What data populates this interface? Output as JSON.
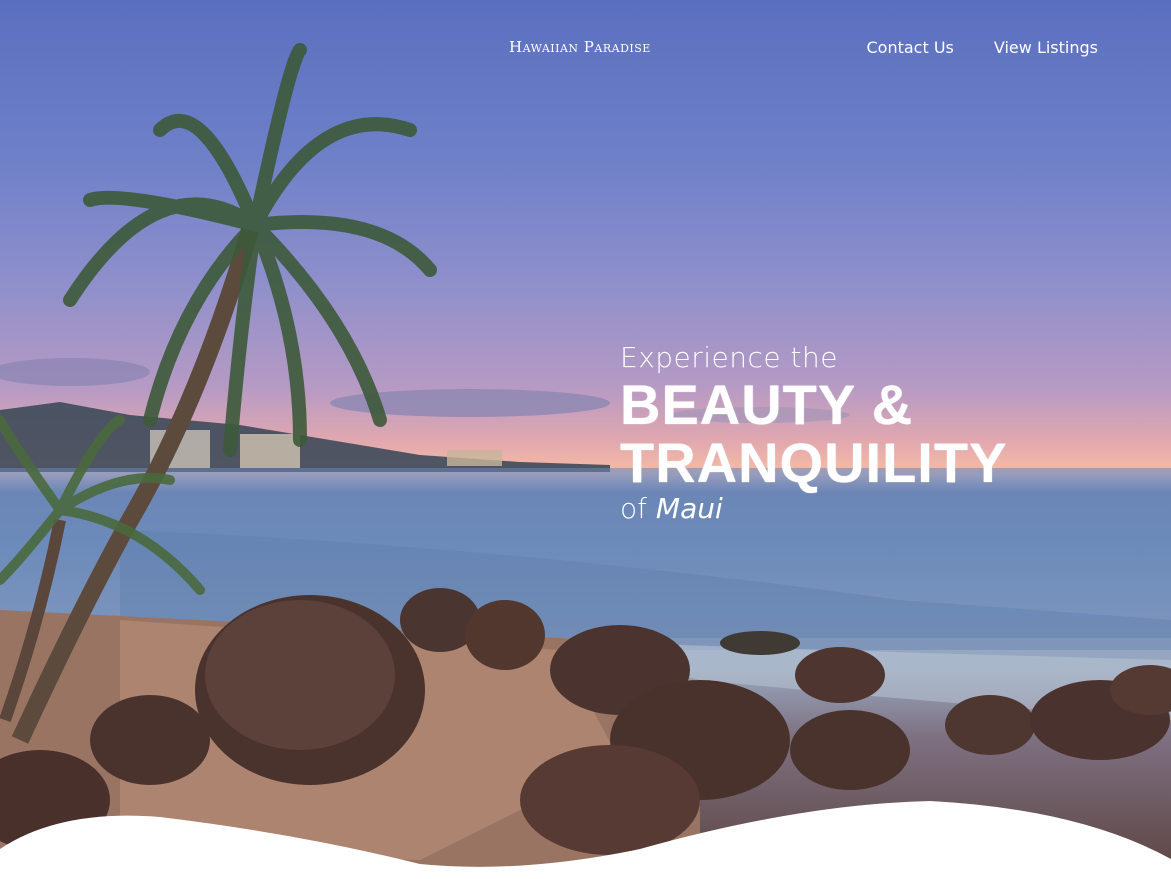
{
  "nav": {
    "brand": "Hawaiian Paradise",
    "links": [
      {
        "label": "Contact Us"
      },
      {
        "label": "View Listings"
      }
    ]
  },
  "hero": {
    "line1": "Experience the",
    "line2": "BEAUTY &",
    "line3": "TRANQUILITY",
    "line4_prefix": "of",
    "line4_emphasis": "Maui"
  },
  "colors": {
    "text": "#ffffff",
    "wave": "#ffffff",
    "sky_top": "#5a6fbf",
    "sunset": "#f2b7a6"
  }
}
